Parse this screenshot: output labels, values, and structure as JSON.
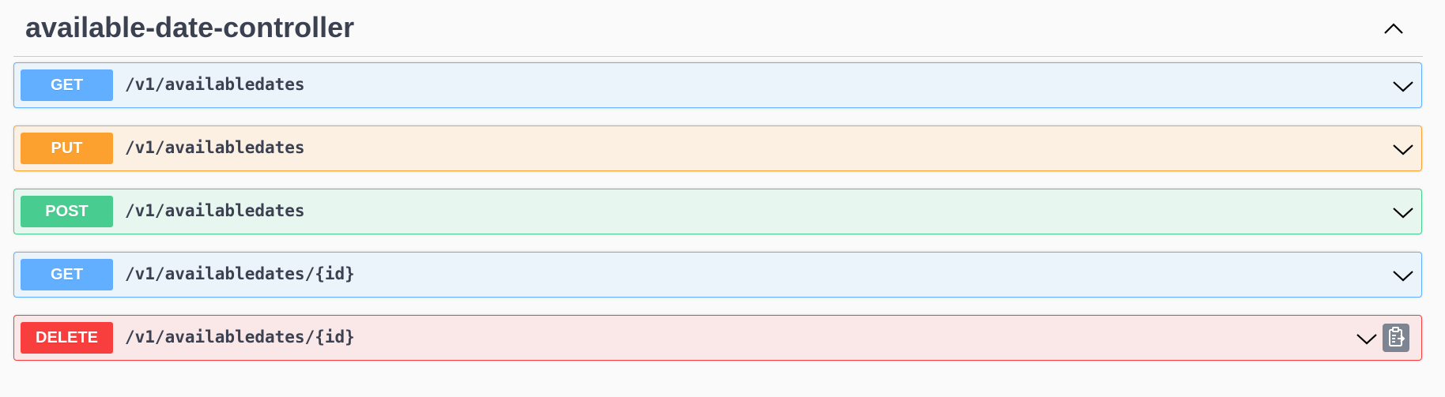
{
  "tag": {
    "title": "available-date-controller",
    "collapse_icon": "chevron-up-icon"
  },
  "operations": [
    {
      "method": "GET",
      "path": "/v1/availabledates",
      "color": "#61affe"
    },
    {
      "method": "PUT",
      "path": "/v1/availabledates",
      "color": "#fca130"
    },
    {
      "method": "POST",
      "path": "/v1/availabledates",
      "color": "#49cc90"
    },
    {
      "method": "GET",
      "path": "/v1/availabledates/{id}",
      "color": "#61affe"
    },
    {
      "method": "DELETE",
      "path": "/v1/availabledates/{id}",
      "color": "#f93e3e",
      "copy_icon": "clipboard-copy-icon"
    }
  ],
  "colors": {
    "background": "#fafafa",
    "text": "#3b4151"
  }
}
